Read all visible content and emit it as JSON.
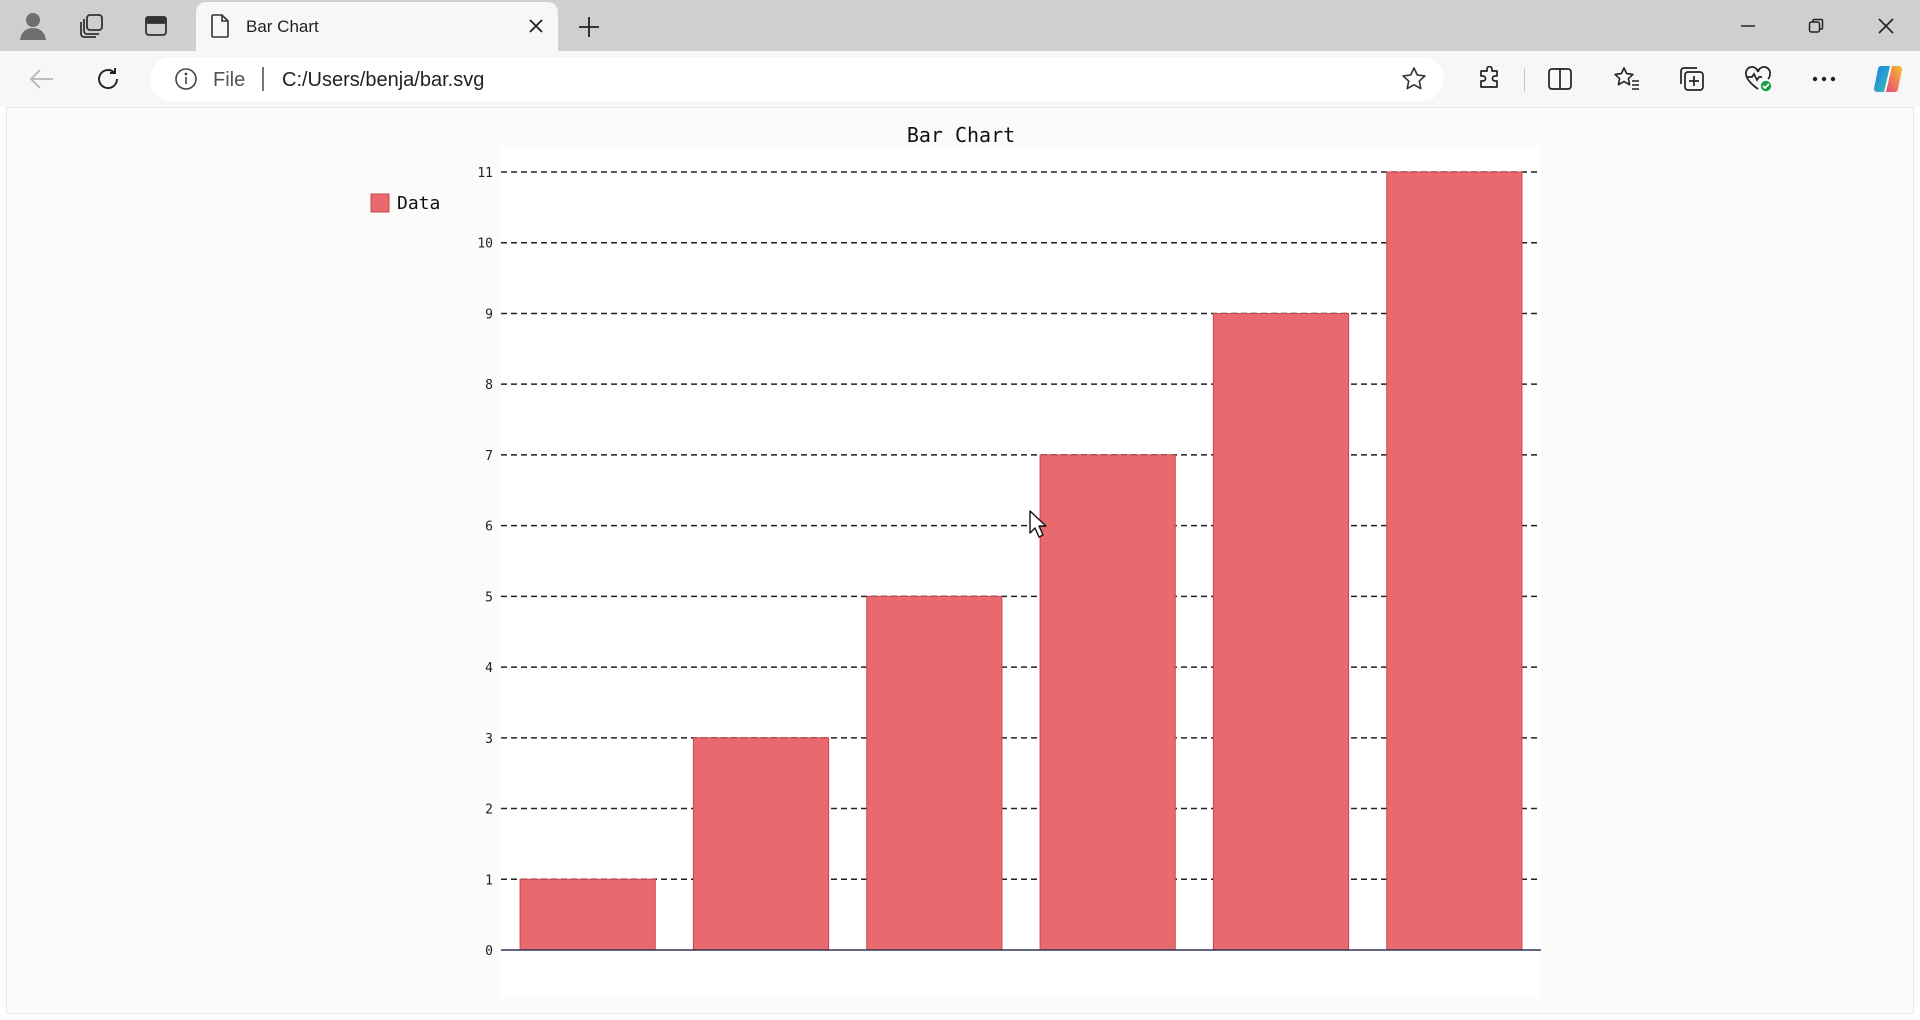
{
  "browser": {
    "tab": {
      "title": "Bar Chart"
    },
    "address": {
      "scheme": "File",
      "url": "C:/Users/benja/bar.svg"
    }
  },
  "icons": {
    "profile": "profile-icon",
    "workspaces": "workspaces-icon",
    "tab_actions": "tab-actions-icon",
    "favicon": "file-icon",
    "close": "close-icon",
    "new_tab": "plus-icon",
    "minimize": "minimize-icon",
    "restore": "restore-icon",
    "window_close": "close-icon",
    "back": "arrow-left-icon",
    "refresh": "refresh-icon",
    "info": "info-icon",
    "favorite": "star-icon",
    "extensions": "puzzle-icon",
    "split_screen": "split-screen-icon",
    "favorites": "favorites-icon",
    "collections": "collections-icon",
    "browser_essentials": "heart-pulse-icon",
    "more": "ellipsis-icon",
    "copilot": "copilot-icon"
  },
  "colors": {
    "bar_fill": "#e86a6e",
    "bar_stroke": "#c9474c",
    "axis": "#30305a",
    "grid": "#222222"
  },
  "chart_data": {
    "type": "bar",
    "title": "Bar Chart",
    "categories": [
      "",
      "",
      "",
      "",
      "",
      ""
    ],
    "series": [
      {
        "name": "Data",
        "values": [
          1,
          3,
          5,
          7,
          9,
          11
        ]
      }
    ],
    "yticks": [
      "0",
      "1",
      "2",
      "3",
      "4",
      "5",
      "6",
      "7",
      "8",
      "9",
      "10",
      "11"
    ],
    "ylim": [
      0,
      11
    ],
    "grid": true,
    "legend": "top-left"
  }
}
